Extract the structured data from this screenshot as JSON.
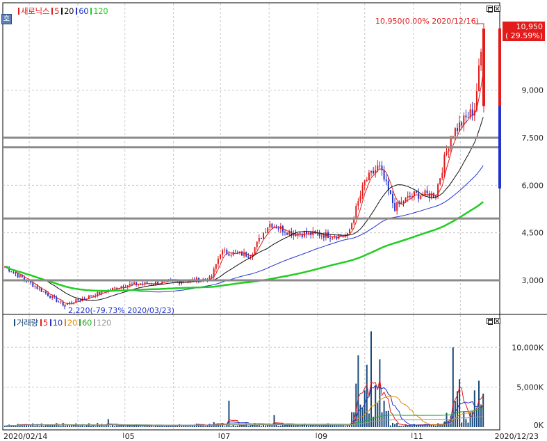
{
  "legend_price": {
    "name": "새로닉스",
    "ma5": "5",
    "ma20": "20",
    "ma60": "60",
    "ma120": "120"
  },
  "legend_volume": {
    "name": "거래량",
    "ma5": "5",
    "ma10": "10",
    "ma20": "20",
    "ma60": "60",
    "ma120": "120"
  },
  "price_tag": {
    "price": "10,950",
    "change": "( 29.59%)"
  },
  "annotations": {
    "high": "10,950(0.00% 2020/12/16)",
    "low": "2,220(-79.73% 2020/03/23)"
  },
  "side_badge": "호",
  "colors": {
    "up": "#e21b1b",
    "down": "#2233cc",
    "ma5": "#e21b1b",
    "ma20": "#111111",
    "ma60": "#2233cc",
    "ma120": "#22cc22",
    "vol10": "#2233cc",
    "vol20": "#e08a00",
    "vol60": "#22aa22",
    "vol120": "#999999",
    "volume": "#1a4a7a"
  },
  "chart_data": [
    {
      "type": "candlestick",
      "title": "새로닉스",
      "y_axis_ticks": [
        "3,000",
        "4,500",
        "6,000",
        "7,500",
        "9,000",
        "10,950"
      ],
      "ylim": [
        1800,
        10950
      ],
      "x_axis_ticks": [
        "2020/02/14",
        "05",
        "07",
        "09",
        "11",
        "2020/12/23"
      ],
      "horizontal_lines": [
        7500,
        7200,
        4950,
        3000
      ],
      "price_points": [
        {
          "date": "2020/02/14",
          "close": 3450
        },
        {
          "date": "2020/03/23",
          "low": 2220
        },
        {
          "date": "2020/04/15",
          "close": 2600
        },
        {
          "date": "2020/05/01",
          "close": 2850
        },
        {
          "date": "2020/06/01",
          "close": 2950
        },
        {
          "date": "2020/06/25",
          "close": 3050
        },
        {
          "date": "2020/07/01",
          "close": 3900
        },
        {
          "date": "2020/07/20",
          "close": 3800
        },
        {
          "date": "2020/08/01",
          "close": 4800
        },
        {
          "date": "2020/08/15",
          "close": 4500
        },
        {
          "date": "2020/09/01",
          "close": 4450
        },
        {
          "date": "2020/09/20",
          "close": 4400
        },
        {
          "date": "2020/10/01",
          "close": 6100
        },
        {
          "date": "2020/10/10",
          "close": 6600
        },
        {
          "date": "2020/10/20",
          "close": 5300
        },
        {
          "date": "2020/11/01",
          "close": 5700
        },
        {
          "date": "2020/11/15",
          "close": 5700
        },
        {
          "date": "2020/11/25",
          "close": 7600
        },
        {
          "date": "2020/12/10",
          "close": 8400
        },
        {
          "date": "2020/12/16",
          "high": 10950
        },
        {
          "date": "2020/12/23",
          "close": 10950
        }
      ],
      "moving_averages": [
        "5",
        "20",
        "60",
        "120"
      ]
    },
    {
      "type": "bar",
      "title": "거래량",
      "y_axis_ticks": [
        "10,000K",
        "5,000K",
        "0K"
      ],
      "ylim": [
        0,
        12500
      ],
      "x_axis_ticks": [
        "2020/02/14",
        "05",
        "07",
        "09",
        "11",
        "2020/12/23"
      ],
      "unit": "K"
    }
  ]
}
